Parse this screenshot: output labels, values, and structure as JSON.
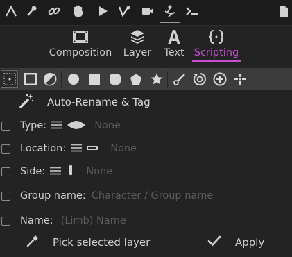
{
  "toolbar": {
    "icons": [
      "animation-icon",
      "pin-icon",
      "link-icon",
      "hand-icon",
      "play-icon",
      "bone-icon",
      "camera-icon",
      "rig-icon",
      "terminal-icon",
      "document-icon"
    ]
  },
  "tabs": [
    {
      "label": "Composition",
      "icon": "film-icon",
      "active": false
    },
    {
      "label": "Layer",
      "icon": "layers-icon",
      "active": false
    },
    {
      "label": "Text",
      "icon": "text-icon",
      "active": false
    },
    {
      "label": "Scripting",
      "icon": "braces-icon",
      "active": true
    }
  ],
  "auto_rename": {
    "label": "Auto-Rename & Tag",
    "icon": "magic-wand-icon"
  },
  "fields": {
    "type": {
      "label": "Type:",
      "value": "None"
    },
    "location": {
      "label": "Location:",
      "value": "None"
    },
    "side": {
      "label": "Side:",
      "value": "None"
    },
    "group_name": {
      "label": "Group name:",
      "placeholder": "Character / Group name"
    },
    "name": {
      "label": "Name:",
      "placeholder": "(Limb) Name"
    }
  },
  "actions": {
    "pick_label": "Pick selected layer",
    "apply_label": "Apply"
  },
  "colors": {
    "accent": "#c64fd1",
    "background": "#232323"
  }
}
